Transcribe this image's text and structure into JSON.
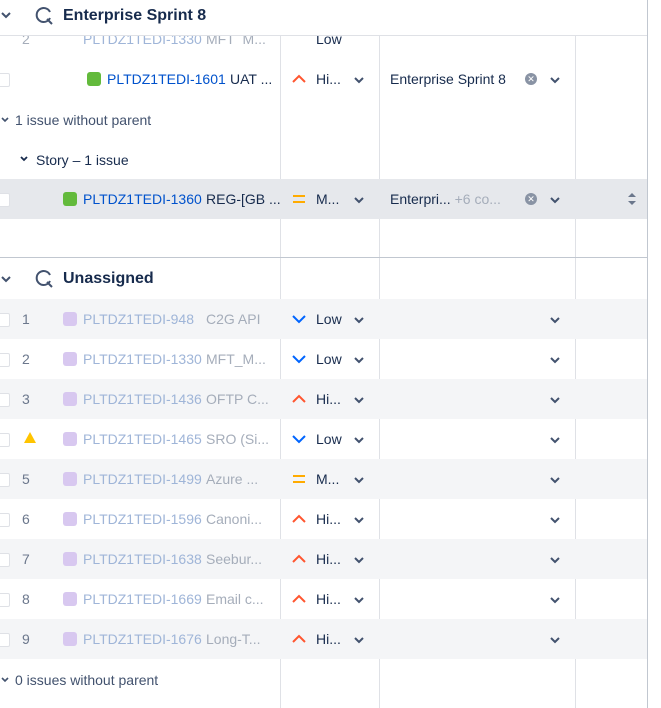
{
  "groups": {
    "sprint": {
      "title": "Enterprise Sprint 8"
    },
    "unassigned": {
      "title": "Unassigned"
    }
  },
  "partial_row": {
    "num": "2",
    "key": "PLTDZ1TEDI-1330",
    "summary": "MFT_M...",
    "priority": "Low"
  },
  "child_row": {
    "key": "PLTDZ1TEDI-1601",
    "summary": "UAT ...",
    "priority": "Hi...",
    "sprint": "Enterprise Sprint 8"
  },
  "no_parent_1": "1 issue without parent",
  "story_group": "Story – 1 issue",
  "story_row": {
    "key": "PLTDZ1TEDI-1360",
    "summary": "REG-[GB ...",
    "priority": "M...",
    "sprint": "Enterpri...",
    "more": "+6 co..."
  },
  "unassigned_rows": [
    {
      "num": "1",
      "key": "PLTDZ1TEDI-948",
      "summary": "C2G API",
      "priority": "Low",
      "prio_type": "low"
    },
    {
      "num": "2",
      "key": "PLTDZ1TEDI-1330",
      "summary": "MFT_M...",
      "priority": "Low",
      "prio_type": "low"
    },
    {
      "num": "3",
      "key": "PLTDZ1TEDI-1436",
      "summary": "OFTP C...",
      "priority": "Hi...",
      "prio_type": "high"
    },
    {
      "num": "",
      "key": "PLTDZ1TEDI-1465",
      "summary": "SRO (Si...",
      "priority": "Low",
      "prio_type": "low",
      "warning": true
    },
    {
      "num": "5",
      "key": "PLTDZ1TEDI-1499",
      "summary": "Azure ...",
      "priority": "M...",
      "prio_type": "medium"
    },
    {
      "num": "6",
      "key": "PLTDZ1TEDI-1596",
      "summary": "Canoni...",
      "priority": "Hi...",
      "prio_type": "high"
    },
    {
      "num": "7",
      "key": "PLTDZ1TEDI-1638",
      "summary": "Seebur...",
      "priority": "Hi...",
      "prio_type": "high"
    },
    {
      "num": "8",
      "key": "PLTDZ1TEDI-1669",
      "summary": "Email c...",
      "priority": "Hi...",
      "prio_type": "high"
    },
    {
      "num": "9",
      "key": "PLTDZ1TEDI-1676",
      "summary": "Long-T...",
      "priority": "Hi...",
      "prio_type": "high"
    }
  ],
  "no_parent_2": "0 issues without parent",
  "colors": {
    "link": "#0052cc",
    "low": "#0065ff",
    "high": "#ff5630",
    "medium": "#ffab00",
    "story": "#63ba3c",
    "epic": "#d8c8f0"
  }
}
